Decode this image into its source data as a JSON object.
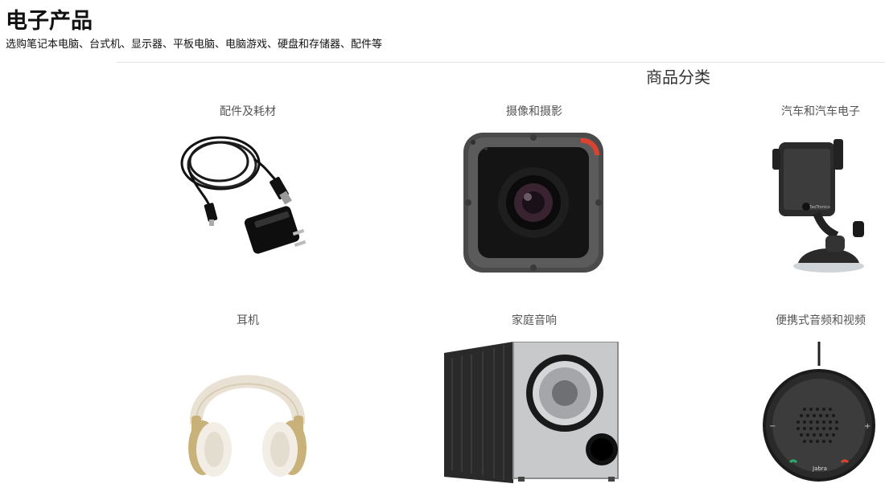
{
  "header": {
    "title": "电子产品",
    "subtitle": "选购笔记本电脑、台式机、显示器、平板电脑、电脑游戏、硬盘和存储器、配件等"
  },
  "section": {
    "heading": "商品分类"
  },
  "categories": [
    {
      "label": "配件及耗材",
      "icon": "charger-cable-image"
    },
    {
      "label": "摄像和摄影",
      "icon": "action-camera-image"
    },
    {
      "label": "汽车和汽车电子",
      "icon": "car-phone-mount-image"
    },
    {
      "label": "耳机",
      "icon": "headphones-image"
    },
    {
      "label": "家庭音响",
      "icon": "subwoofer-image"
    },
    {
      "label": "便携式音频和视频",
      "icon": "speakerphone-image"
    }
  ],
  "product_text": {
    "mount_brand": "TaoTronics",
    "speaker_brand": "Jabra"
  }
}
